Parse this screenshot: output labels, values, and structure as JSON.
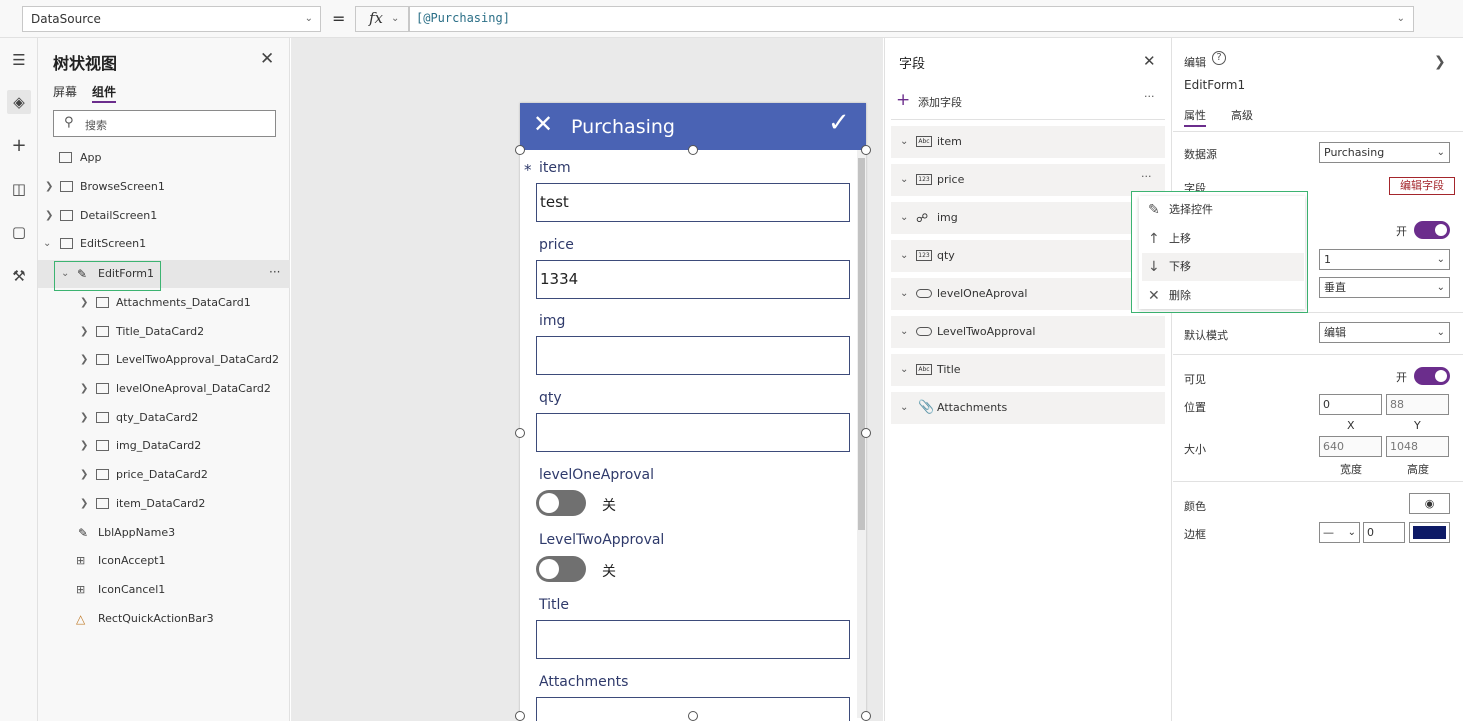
{
  "formula_bar": {
    "property": "DataSource",
    "equals": "=",
    "fx": "fx",
    "formula": "[@Purchasing]"
  },
  "tree_view": {
    "title": "树状视图",
    "tabs": [
      "屏幕",
      "组件"
    ],
    "search_placeholder": "搜索",
    "items": [
      "App",
      "BrowseScreen1",
      "DetailScreen1",
      "EditScreen1",
      "EditForm1",
      "Attachments_DataCard1",
      "Title_DataCard2",
      "LevelTwoApproval_DataCard2",
      "levelOneAproval_DataCard2",
      "qty_DataCard2",
      "img_DataCard2",
      "price_DataCard2",
      "item_DataCard2",
      "LblAppName3",
      "IconAccept1",
      "IconCancel1",
      "RectQuickActionBar3"
    ],
    "more": "···"
  },
  "form": {
    "title": "Purchasing",
    "required_mark": "*",
    "fields": [
      {
        "label": "item",
        "value": "test"
      },
      {
        "label": "price",
        "value": "1334"
      },
      {
        "label": "img",
        "value": ""
      },
      {
        "label": "qty",
        "value": ""
      },
      {
        "label": "levelOneAproval",
        "toggle": "关"
      },
      {
        "label": "LevelTwoApproval",
        "toggle": "关"
      },
      {
        "label": "Title",
        "value": ""
      },
      {
        "label": "Attachments",
        "value": "...​"
      }
    ]
  },
  "fields_panel": {
    "title": "字段",
    "add_field": "添加字段",
    "more": "···",
    "fields": [
      {
        "name": "item",
        "type": "Abc"
      },
      {
        "name": "price",
        "type": "123"
      },
      {
        "name": "img",
        "type": "img"
      },
      {
        "name": "qty",
        "type": "123"
      },
      {
        "name": "levelOneAproval",
        "type": "toggle"
      },
      {
        "name": "LevelTwoApproval",
        "type": "toggle"
      },
      {
        "name": "Title",
        "type": "Abc"
      },
      {
        "name": "Attachments",
        "type": "attach"
      }
    ]
  },
  "context_menu": {
    "items": [
      "选择控件",
      "上移",
      "下移",
      "删除"
    ]
  },
  "properties": {
    "header": "编辑",
    "control_name": "EditForm1",
    "tabs": [
      "属性",
      "高级"
    ],
    "data_source_label": "数据源",
    "data_source_value": "Purchasing",
    "fields_label": "字段",
    "edit_fields_link": "编辑字段",
    "snap_on": "开",
    "columns_value": "1",
    "layout_value": "垂直",
    "default_mode_label": "默认模式",
    "default_mode_value": "编辑",
    "visible_label": "可见",
    "visible_on": "开",
    "position_label": "位置",
    "x": "0",
    "y": "88",
    "x_caption": "X",
    "y_caption": "Y",
    "size_label": "大小",
    "width": "640",
    "height": "1048",
    "width_caption": "宽度",
    "height_caption": "高度",
    "color_label": "颜色",
    "border_label": "边框",
    "border_style": "—",
    "border_width": "0",
    "border_color": "#0d1a66",
    "accent": "#6b2d8c"
  }
}
